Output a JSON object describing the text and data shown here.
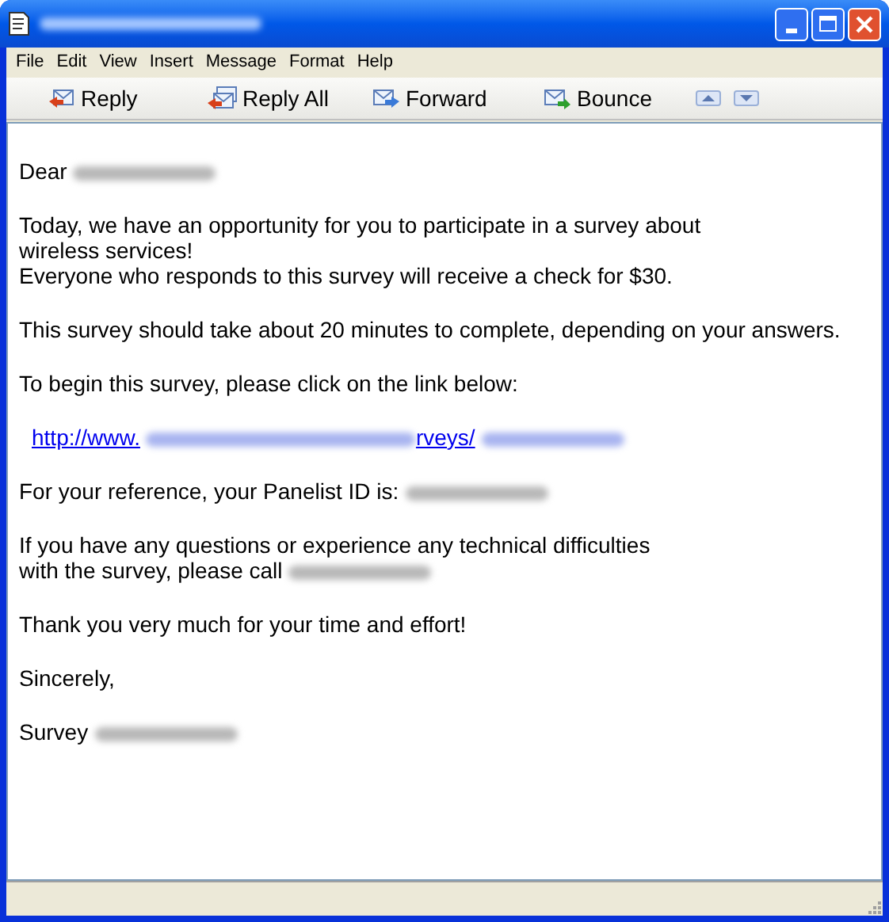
{
  "menu": [
    "File",
    "Edit",
    "View",
    "Insert",
    "Message",
    "Format",
    "Help"
  ],
  "toolbar": [
    {
      "kind": "reply",
      "label": "Reply"
    },
    {
      "kind": "reply_all",
      "label": "Reply All"
    },
    {
      "kind": "forward",
      "label": "Forward"
    },
    {
      "kind": "bounce",
      "label": "Bounce"
    },
    {
      "kind": "up"
    },
    {
      "kind": "down"
    }
  ],
  "body": [
    {
      "kind": "text",
      "lines": [
        [
          {
            "kind": "text",
            "text": "Dear"
          },
          {
            "kind": "blur"
          }
        ]
      ]
    },
    {
      "kind": "text",
      "lines": [
        [
          {
            "kind": "text",
            "text": "Today, we have an opportunity for you to participate in a survey about"
          }
        ],
        [
          {
            "kind": "text",
            "text": "wireless services!"
          }
        ],
        [
          {
            "kind": "text",
            "text": "Everyone who responds to this survey will receive a check for $30."
          }
        ]
      ]
    },
    {
      "kind": "text",
      "lines": [
        [
          {
            "kind": "text",
            "text": "This survey should take about 20 minutes to complete, depending on your answers."
          }
        ]
      ]
    },
    {
      "kind": "text",
      "lines": [
        [
          {
            "kind": "text",
            "text": "To begin this survey, please click on the link below:"
          }
        ]
      ]
    },
    {
      "kind": "link",
      "lines": [
        [
          {
            "kind": "text",
            "text": "http://www."
          },
          {
            "kind": "blur"
          },
          {
            "kind": "text",
            "text": "rveys/"
          },
          {
            "kind": "blur"
          }
        ]
      ]
    },
    {
      "kind": "text",
      "lines": [
        [
          {
            "kind": "text",
            "text": "For your reference, your Panelist ID is:"
          },
          {
            "kind": "blur"
          }
        ]
      ]
    },
    {
      "kind": "text",
      "lines": [
        [
          {
            "kind": "text",
            "text": "If you have any questions or experience any technical difficulties"
          }
        ],
        [
          {
            "kind": "text",
            "text": "with the survey, please call"
          },
          {
            "kind": "blur"
          }
        ]
      ]
    },
    {
      "kind": "text",
      "lines": [
        [
          {
            "kind": "text",
            "text": "Thank you very much for your time and effort!"
          }
        ]
      ]
    },
    {
      "kind": "text",
      "lines": [
        [
          {
            "kind": "text",
            "text": "Sincerely,"
          }
        ]
      ]
    },
    {
      "kind": "text",
      "lines": [
        [
          {
            "kind": "text",
            "text": "Survey"
          },
          {
            "kind": "blur"
          }
        ]
      ]
    }
  ]
}
